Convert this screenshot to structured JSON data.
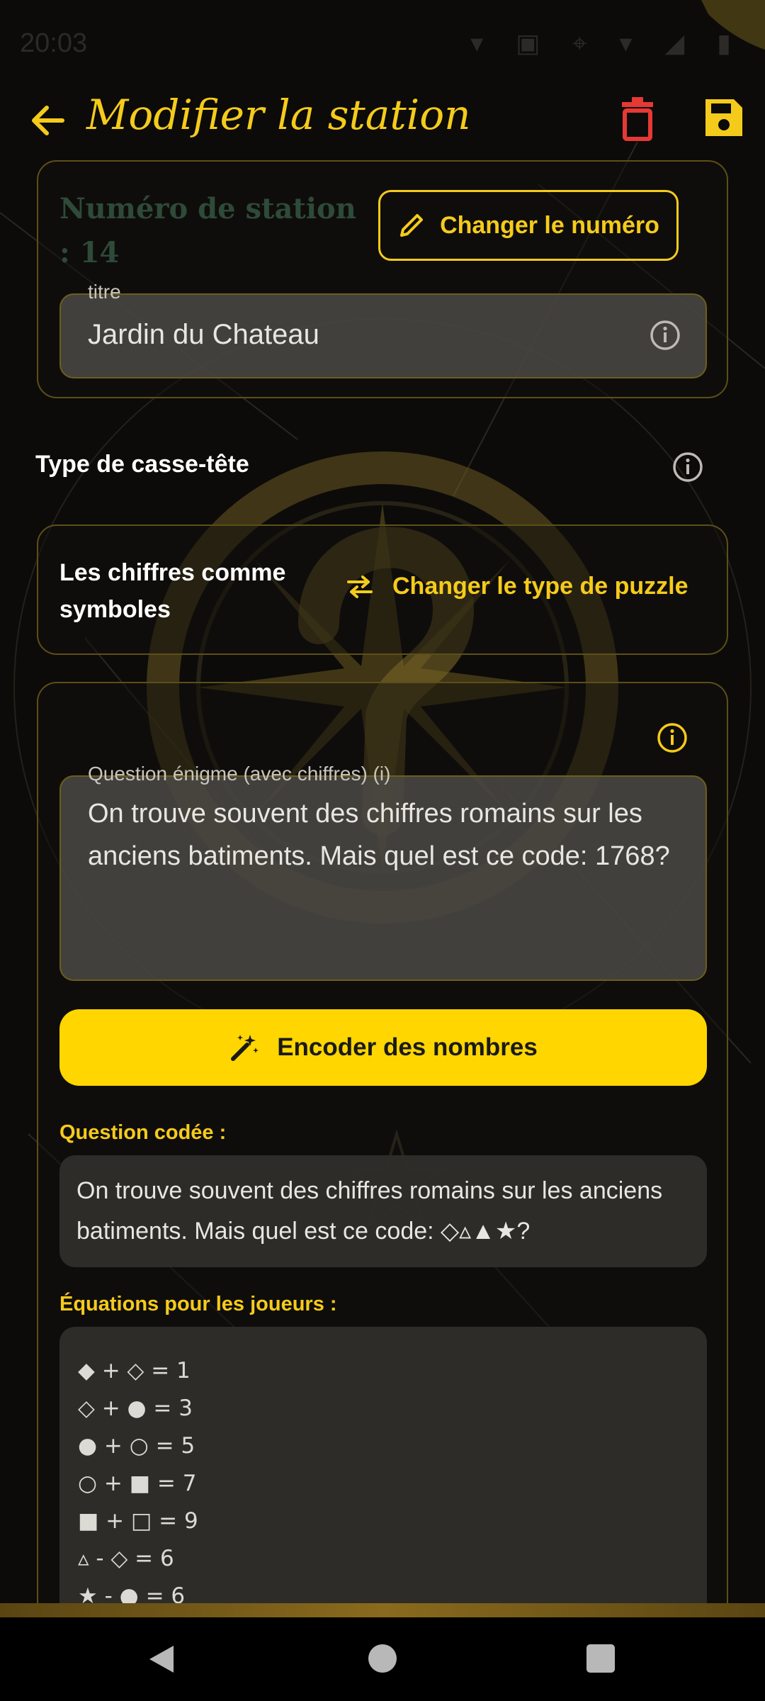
{
  "status_bar": {
    "time": "20:03",
    "icons": "▾ ▣ ⌖ ▾ ◢ ▮"
  },
  "app_bar": {
    "title": "Modifier la station",
    "back_icon": "arrow-left-icon",
    "delete_icon": "trash-icon",
    "save_icon": "save-icon",
    "accent_color": "#f5cb1b",
    "delete_color": "#e53935"
  },
  "station": {
    "label": "Numéro de station : 14",
    "change_number_label": "Changer le numéro",
    "title_field": {
      "label": "titre",
      "value": "Jardin du Chateau"
    }
  },
  "puzzle_type": {
    "label": "Type de casse-tête",
    "value": "Les chiffres comme symboles",
    "change_label": "Changer le type de puzzle"
  },
  "puzzle": {
    "question_field": {
      "label": "Question énigme (avec chiffres) (i)",
      "value": "On trouve souvent des chiffres romains sur les anciens batiments. Mais quel est ce code: 1768?"
    },
    "encode_button_label": "Encoder des nombres",
    "coded_question_label": "Question codée :",
    "coded_question_value": "On trouve souvent des chiffres romains sur les anciens batiments. Mais quel est ce code: ◇▵▲★?",
    "equations_label": "Équations pour les joueurs :",
    "equations": [
      "◆ + ◇ = 1",
      "◇ + ● = 3",
      "● + ○ = 5",
      "○ + ■ = 7",
      "■ + □ = 9",
      "▵ - ◇ = 6",
      "★ - ● = 6"
    ]
  }
}
